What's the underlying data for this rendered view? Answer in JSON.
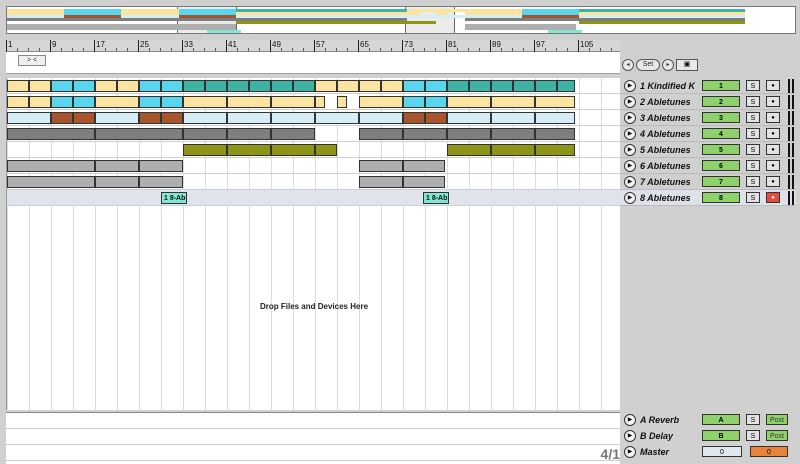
{
  "ruler": {
    "labels": [
      "1",
      "9",
      "17",
      "25",
      "33",
      "41",
      "49",
      "57",
      "65",
      "73",
      "81",
      "89",
      "97",
      "105"
    ]
  },
  "locator": {
    "prev_next": "> <"
  },
  "controls": {
    "set_label": "Set",
    "prev_glyph": "◂",
    "next_glyph": "▸",
    "lock_glyph": "🔒"
  },
  "colors": {
    "teal": "#3fb3a3",
    "cyan": "#57d6ee",
    "yellow": "#fbe3a0",
    "brown": "#a5542c",
    "lightblue": "#d5eef6",
    "gray": "#7e7e7e",
    "olive": "#8e9418",
    "silver": "#aeaeae",
    "mint": "#7fe7d4",
    "green": "#8fd16a",
    "arm_on": "#e24c3b",
    "orange": "#e8843a"
  },
  "tracks": [
    {
      "name": "1 Kindified K",
      "number": "1",
      "solo": "S",
      "arm": "●",
      "armed": false,
      "icon": "play-icon",
      "clips": [
        [
          0,
          22,
          "yellow"
        ],
        [
          22,
          44,
          "yellow"
        ],
        [
          44,
          66,
          "cyan"
        ],
        [
          66,
          88,
          "cyan"
        ],
        [
          88,
          110,
          "yellow"
        ],
        [
          110,
          132,
          "yellow"
        ],
        [
          132,
          154,
          "cyan"
        ],
        [
          154,
          176,
          "cyan"
        ],
        [
          176,
          198,
          "teal"
        ],
        [
          198,
          220,
          "teal"
        ],
        [
          220,
          242,
          "teal"
        ],
        [
          242,
          264,
          "teal"
        ],
        [
          264,
          286,
          "teal"
        ],
        [
          286,
          308,
          "teal"
        ],
        [
          308,
          330,
          "yellow"
        ],
        [
          330,
          352,
          "yellow"
        ],
        [
          352,
          374,
          "yellow"
        ],
        [
          374,
          396,
          "yellow"
        ],
        [
          396,
          418,
          "cyan"
        ],
        [
          418,
          440,
          "cyan"
        ],
        [
          440,
          462,
          "teal"
        ],
        [
          462,
          484,
          "teal"
        ],
        [
          484,
          506,
          "teal"
        ],
        [
          506,
          528,
          "teal"
        ],
        [
          528,
          550,
          "teal"
        ],
        [
          550,
          568,
          "teal"
        ]
      ]
    },
    {
      "name": "2 Abletunes",
      "number": "2",
      "solo": "S",
      "arm": "●",
      "armed": false,
      "clips": [
        [
          0,
          22,
          "yellow"
        ],
        [
          22,
          44,
          "yellow"
        ],
        [
          44,
          66,
          "cyan"
        ],
        [
          66,
          88,
          "cyan"
        ],
        [
          88,
          132,
          "yellow"
        ],
        [
          132,
          154,
          "cyan"
        ],
        [
          154,
          176,
          "cyan"
        ],
        [
          176,
          220,
          "yellow"
        ],
        [
          220,
          264,
          "yellow"
        ],
        [
          264,
          308,
          "yellow"
        ],
        [
          308,
          318,
          "yellow"
        ],
        [
          330,
          340,
          "yellow"
        ],
        [
          352,
          396,
          "yellow"
        ],
        [
          396,
          418,
          "cyan"
        ],
        [
          418,
          440,
          "cyan"
        ],
        [
          440,
          484,
          "yellow"
        ],
        [
          484,
          528,
          "yellow"
        ],
        [
          528,
          568,
          "yellow"
        ]
      ]
    },
    {
      "name": "3 Abletunes",
      "number": "3",
      "solo": "S",
      "arm": "●",
      "armed": false,
      "clips": [
        [
          0,
          44,
          "lightblue"
        ],
        [
          44,
          66,
          "brown"
        ],
        [
          66,
          88,
          "brown"
        ],
        [
          88,
          132,
          "lightblue"
        ],
        [
          132,
          154,
          "brown"
        ],
        [
          154,
          176,
          "brown"
        ],
        [
          176,
          220,
          "lightblue"
        ],
        [
          220,
          264,
          "lightblue"
        ],
        [
          264,
          308,
          "lightblue"
        ],
        [
          308,
          352,
          "lightblue"
        ],
        [
          352,
          396,
          "lightblue"
        ],
        [
          396,
          418,
          "brown"
        ],
        [
          418,
          440,
          "brown"
        ],
        [
          440,
          484,
          "lightblue"
        ],
        [
          484,
          528,
          "lightblue"
        ],
        [
          528,
          568,
          "lightblue"
        ]
      ]
    },
    {
      "name": "4 Abletunes",
      "number": "4",
      "solo": "S",
      "arm": "●",
      "armed": false,
      "clips": [
        [
          0,
          88,
          "gray"
        ],
        [
          88,
          176,
          "gray"
        ],
        [
          176,
          220,
          "gray"
        ],
        [
          220,
          264,
          "gray"
        ],
        [
          264,
          308,
          "gray"
        ],
        [
          352,
          396,
          "gray"
        ],
        [
          396,
          440,
          "gray"
        ],
        [
          440,
          484,
          "gray"
        ],
        [
          484,
          528,
          "gray"
        ],
        [
          528,
          568,
          "gray"
        ]
      ]
    },
    {
      "name": "5 Abletunes",
      "number": "5",
      "solo": "S",
      "arm": "●",
      "armed": false,
      "clips": [
        [
          176,
          220,
          "olive"
        ],
        [
          220,
          264,
          "olive"
        ],
        [
          264,
          308,
          "olive"
        ],
        [
          308,
          330,
          "olive"
        ],
        [
          440,
          484,
          "olive"
        ],
        [
          484,
          528,
          "olive"
        ],
        [
          528,
          568,
          "olive"
        ]
      ]
    },
    {
      "name": "6 Abletunes",
      "number": "6",
      "solo": "S",
      "arm": "●",
      "armed": false,
      "clips": [
        [
          0,
          88,
          "silver"
        ],
        [
          88,
          132,
          "silver"
        ],
        [
          132,
          176,
          "silver"
        ],
        [
          352,
          396,
          "silver"
        ],
        [
          396,
          438,
          "silver"
        ]
      ]
    },
    {
      "name": "7 Abletunes",
      "number": "7",
      "solo": "S",
      "arm": "●",
      "armed": false,
      "clips": [
        [
          0,
          88,
          "silver"
        ],
        [
          88,
          132,
          "silver"
        ],
        [
          132,
          176,
          "silver"
        ],
        [
          352,
          396,
          "silver"
        ],
        [
          396,
          438,
          "silver"
        ]
      ]
    },
    {
      "name": "8 Abletunes",
      "number": "8",
      "solo": "S",
      "arm": "●",
      "armed": true,
      "clips": [
        [
          154,
          180,
          "mint",
          "1 8-Ab"
        ],
        [
          416,
          442,
          "mint",
          "1 8-Ab"
        ]
      ]
    }
  ],
  "drop_text": "Drop Files and Devices Here",
  "returns": [
    {
      "name": "A Reverb",
      "letter": "A",
      "solo": "S",
      "post": "Post"
    },
    {
      "name": "B Delay",
      "letter": "B",
      "solo": "S",
      "post": "Post"
    }
  ],
  "master": {
    "name": "Master",
    "vol_a": "0",
    "vol_b": "0"
  },
  "signature": "4/1"
}
